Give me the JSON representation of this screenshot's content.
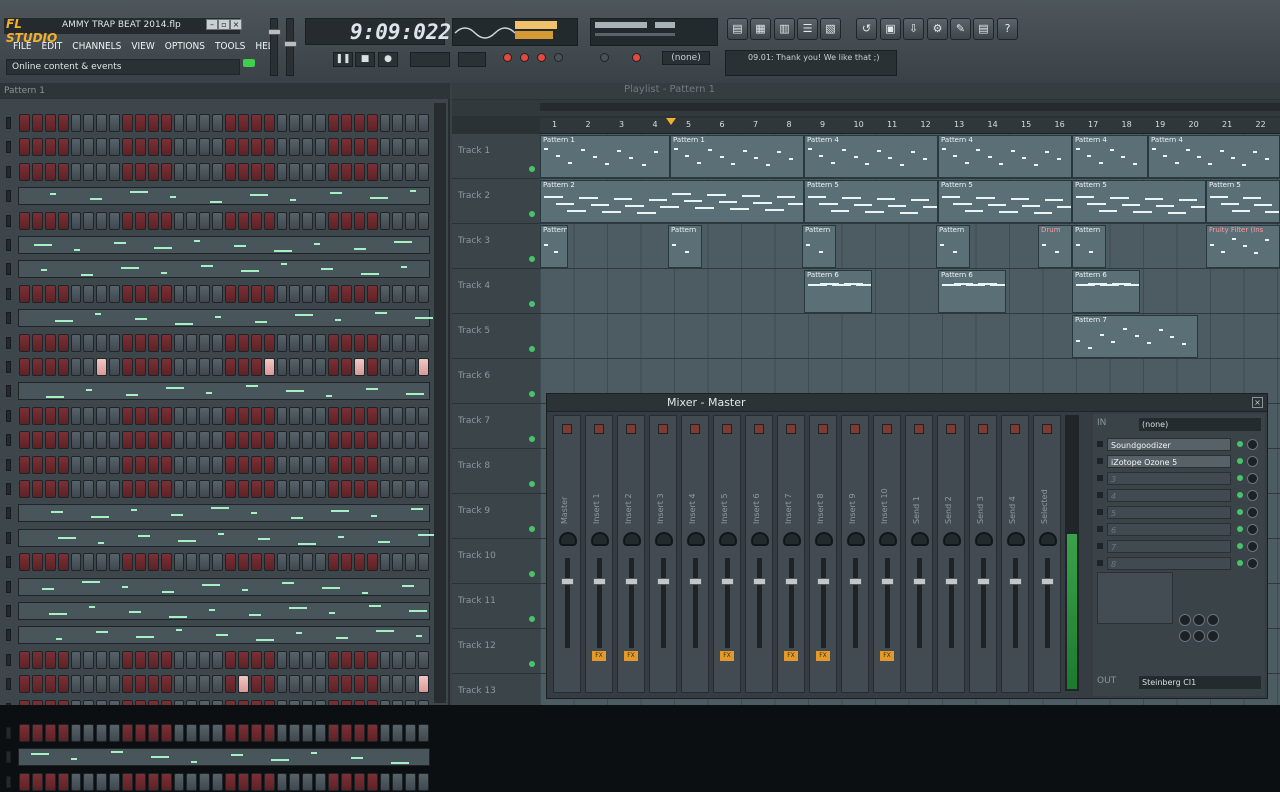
{
  "app": {
    "logo": "FL STUDIO",
    "project_name": "AMMY TRAP BEAT 2014.flp",
    "menu": [
      "FILE",
      "EDIT",
      "CHANNELS",
      "VIEW",
      "OPTIONS",
      "TOOLS",
      "HELP"
    ],
    "hint": "Online content & events",
    "song_time": "9:09:022",
    "pattern_selector": "(none)",
    "news_ticker": "09.01: Thank you! We like that ;)",
    "accent_color": "#f4b028"
  },
  "step_sequencer": {
    "title": "Pattern 1"
  },
  "playlist": {
    "title": "Playlist - Pattern 1",
    "bars": [
      "1",
      "2",
      "3",
      "4",
      "5",
      "6",
      "7",
      "8",
      "9",
      "10",
      "11",
      "12",
      "13",
      "14",
      "15",
      "16",
      "17",
      "18",
      "19",
      "20",
      "21",
      "22"
    ],
    "tracks": [
      "Track 1",
      "Track 2",
      "Track 3",
      "Track 4",
      "Track 5",
      "Track 6",
      "Track 7",
      "Track 8",
      "Track 9",
      "Track 10",
      "Track 11",
      "Track 12",
      "Track 13"
    ],
    "clips": {
      "t1": [
        "Pattern 1",
        "Pattern 1",
        "Pattern 4",
        "Pattern 4",
        "Pattern 4",
        "Pattern 4"
      ],
      "t2": [
        "Pattern 2",
        "Pattern 5",
        "Pattern 5",
        "Pattern 5",
        "Pattern 5"
      ],
      "t3": [
        "Pattern",
        "Pattern",
        "Pattern",
        "Pattern",
        "Drum",
        "Pattern",
        "Fruity Filter (Ins"
      ],
      "t4": [
        "Pattern 6",
        "Pattern 6",
        "Pattern 6"
      ],
      "t5": [
        "Pattern 7"
      ]
    }
  },
  "mixer": {
    "title": "Mixer - Master",
    "strips": [
      "Master",
      "Insert 1",
      "Insert 2",
      "Insert 3",
      "Insert 4",
      "Insert 5",
      "Insert 6",
      "Insert 7",
      "Insert 8",
      "Insert 9",
      "Insert 10",
      "Send 1",
      "Send 2",
      "Send 3",
      "Send 4",
      "Selected"
    ],
    "fx_label": "FX",
    "in_label": "IN",
    "in_value": "(none)",
    "slots": [
      "Soundgoodizer",
      "iZotope Ozone 5",
      "3",
      "4",
      "5",
      "6",
      "7",
      "8"
    ],
    "out_label": "OUT",
    "out_value": "Steinberg CI1",
    "none_preset": "(none)"
  }
}
